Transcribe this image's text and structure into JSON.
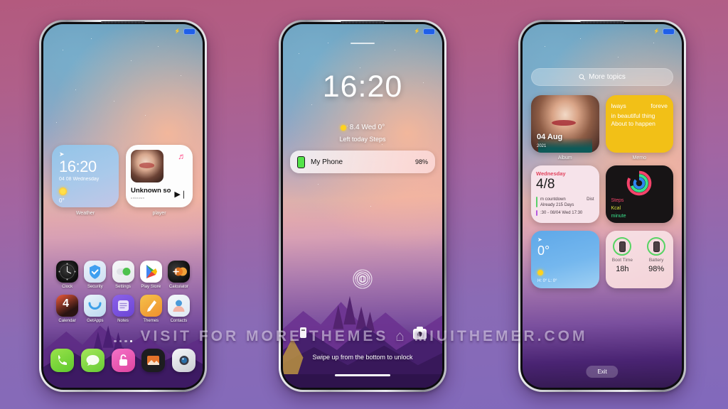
{
  "watermark": "VISIT FOR MORE THEMES ⌂ MIUITHEMER.COM",
  "status_bar": {
    "charging_icon": "charging-bolt-icon",
    "battery_icon": "battery-full-icon"
  },
  "phone1": {
    "name": "home-screen",
    "widgets": [
      {
        "type": "weather-clock",
        "label": "Weather",
        "time": "16:20",
        "date": "04 08 Wednesday",
        "temperature": "0°",
        "location_icon": "location-arrow-icon",
        "condition_icon": "sun-icon"
      },
      {
        "type": "music-player",
        "label": "player",
        "title": "Unknown so",
        "subtitle": "unknown",
        "note_icon": "music-note-icon",
        "play_icon": "play-next-icon"
      }
    ],
    "apps_row1": [
      {
        "name": "Clock",
        "icon": "clock-icon"
      },
      {
        "name": "Security",
        "icon": "security-shield-icon"
      },
      {
        "name": "Settings",
        "icon": "settings-toggle-icon"
      },
      {
        "name": "Play Store",
        "icon": "play-store-icon"
      },
      {
        "name": "Calculator",
        "icon": "calculator-icon"
      }
    ],
    "apps_row2": [
      {
        "name": "Calendar",
        "icon": "calendar-icon",
        "badge": "4"
      },
      {
        "name": "GetApps",
        "icon": "getapps-icon"
      },
      {
        "name": "Notes",
        "icon": "notes-icon"
      },
      {
        "name": "Themes",
        "icon": "themes-icon"
      },
      {
        "name": "Contacts",
        "icon": "contacts-icon"
      }
    ],
    "page_dots": 4,
    "active_dot": 4,
    "dock": [
      {
        "name": "Phone",
        "icon": "phone-icon"
      },
      {
        "name": "Messages",
        "icon": "messages-icon"
      },
      {
        "name": "Security Lock",
        "icon": "lock-icon"
      },
      {
        "name": "Gallery",
        "icon": "gallery-icon"
      },
      {
        "name": "Camera",
        "icon": "camera-icon"
      }
    ]
  },
  "phone2": {
    "name": "lock-screen",
    "time": "16:20",
    "date_line": "8.4 Wed  0°",
    "steps_line": "Left today Steps",
    "notification": {
      "title": "My Phone",
      "value": "98%",
      "icon": "phone-battery-icon"
    },
    "fingerprint_icon": "fingerprint-icon",
    "torch_icon": "flashlight-icon",
    "camera_icon": "camera-icon",
    "hint": "Swipe up from the bottom to unlock"
  },
  "phone3": {
    "name": "widget-picker",
    "search": {
      "placeholder": "More topics",
      "icon": "search-icon"
    },
    "cards": [
      {
        "id": "album",
        "caption": "Album",
        "date": "04 Aug",
        "year": "2021"
      },
      {
        "id": "memo",
        "caption": "Memo",
        "line1_left": "lways",
        "line1_right": "foreve",
        "line2": "in beautiful thing",
        "line3": "About to happen"
      },
      {
        "id": "calendar",
        "caption": "",
        "weekday": "Wednesday",
        "date": "4/8",
        "event1_title": "m countdown",
        "event1_right": "Dist",
        "event1_sub": "Already 215 Days",
        "event2": ":30 - 08/04 Wed 17:30"
      },
      {
        "id": "steps",
        "caption": "",
        "label1": "Steps",
        "label2": "Kcal",
        "label3": "minute"
      },
      {
        "id": "weather",
        "caption": "",
        "temperature": "0°",
        "high_low": "H: 0° L: 0°",
        "location_icon": "location-arrow-icon",
        "condition_icon": "sun-icon"
      },
      {
        "id": "stats",
        "caption": "",
        "stat1_label": "Boot Time",
        "stat1_value": "18h",
        "stat2_label": "Battery",
        "stat2_value": "98%"
      }
    ],
    "exit_label": "Exit"
  }
}
